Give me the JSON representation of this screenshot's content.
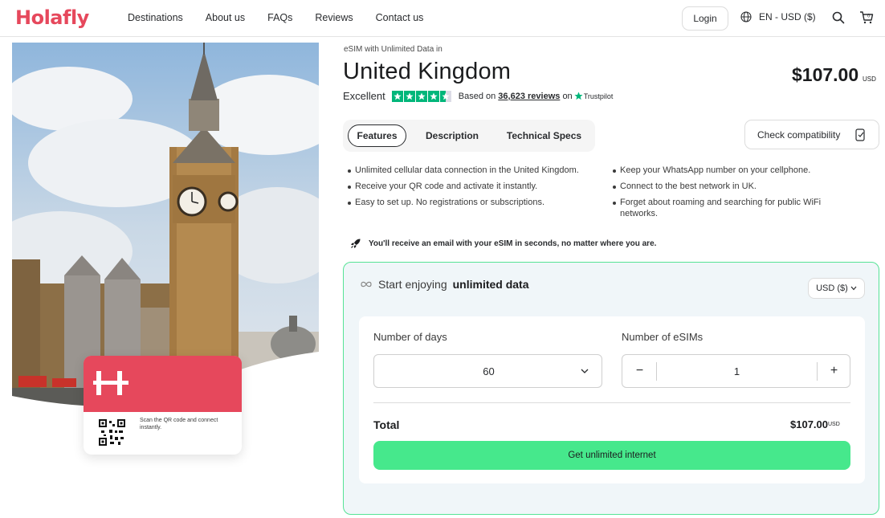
{
  "header": {
    "logo": "Holafly",
    "nav": [
      "Destinations",
      "About us",
      "FAQs",
      "Reviews",
      "Contact us"
    ],
    "login_label": "Login",
    "language": "EN - USD ($)",
    "cart_count": "0"
  },
  "hero": {
    "card_text": "Scan the QR code and connect instantly."
  },
  "product": {
    "eyebrow": "eSIM with Unlimited Data in",
    "title": "United Kingdom",
    "price": "$107.00",
    "price_currency": "USD",
    "rating_word": "Excellent",
    "rating_stars": 4.5,
    "based_on": "Based on",
    "reviews_link": "36,623 reviews",
    "on_text": "on",
    "trustpilot": "Trustpilot"
  },
  "tabs": [
    "Features",
    "Description",
    "Technical Specs"
  ],
  "check_label": "Check compatibility",
  "features_left": [
    "Unlimited cellular data connection in the United Kingdom.",
    "Receive your QR code and activate it instantly.",
    "Easy to set up. No registrations or subscriptions."
  ],
  "features_right": [
    "Keep your WhatsApp number on your cellphone.",
    "Connect to the best network in UK.",
    "Forget about roaming and searching for public WiFi networks."
  ],
  "email_note": "You'll receive an email with your eSIM in seconds, no matter where you are.",
  "panel": {
    "head_text": "Start enjoying",
    "head_bold": "unlimited data",
    "currency": "USD ($)",
    "days_label": "Number of days",
    "days_value": "60",
    "esims_label": "Number of eSIMs",
    "esims_value": "1",
    "total_label": "Total",
    "total_value": "$107.00",
    "total_currency": "USD",
    "buy_label": "Get unlimited internet"
  },
  "colors": {
    "brand": "#e6485c",
    "accent_green": "#46e88c",
    "trustpilot_green": "#00b67a"
  }
}
